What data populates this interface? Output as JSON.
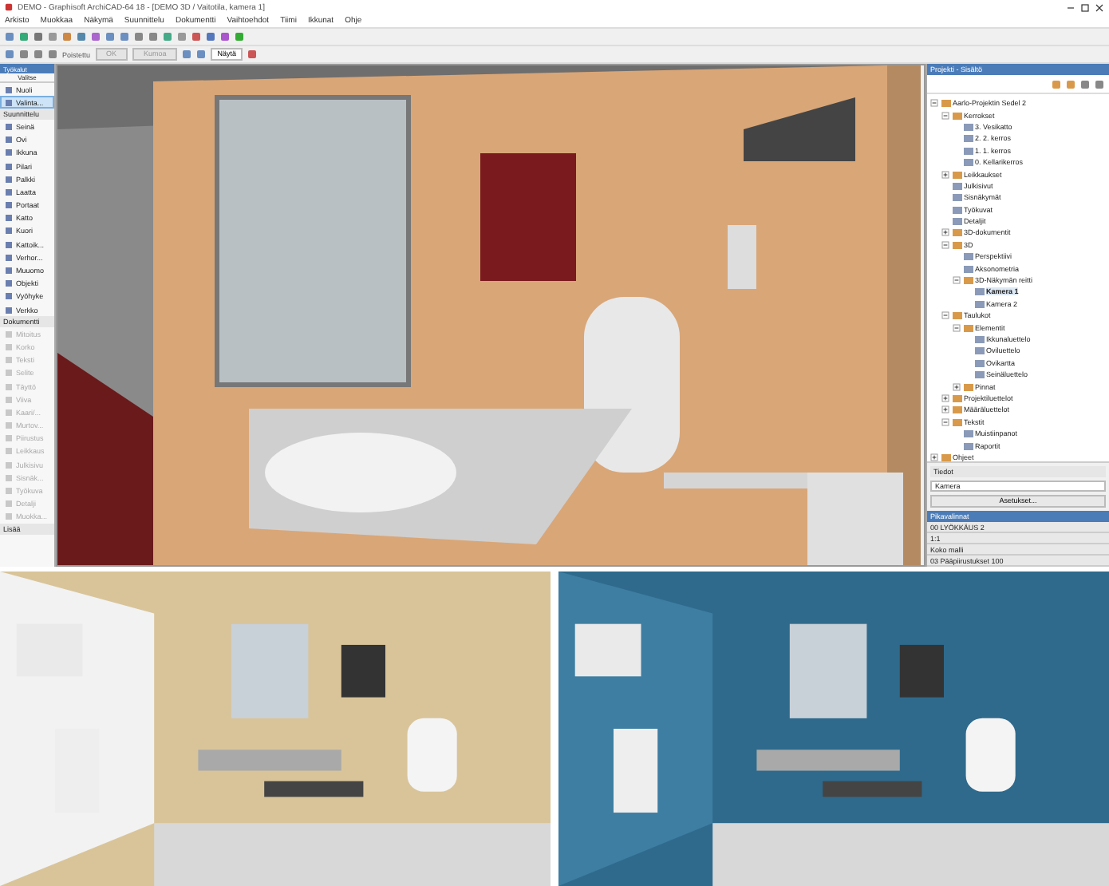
{
  "window": {
    "title": "DEMO - Graphisoft ArchiCAD-64 18 - [DEMO 3D / Vaitotila, kamera 1]"
  },
  "menu": [
    "Arkisto",
    "Muokkaa",
    "Näkymä",
    "Suunnittelu",
    "Dokumentti",
    "Vaihtoehdot",
    "Tiimi",
    "Ikkunat",
    "Ohje"
  ],
  "info_box": {
    "label": "Poistettu",
    "buttons": [
      "OK",
      "Kumoa"
    ],
    "dropdown": "Näytä"
  },
  "toolbox": {
    "title": "Työkalut",
    "mode": "Valitse",
    "items": [
      {
        "kind": "tool",
        "label": "Nuoli",
        "selected": false,
        "disabled": false
      },
      {
        "kind": "tool",
        "label": "Valinta...",
        "selected": true,
        "disabled": false
      },
      {
        "kind": "section",
        "label": "Suunnittelu"
      },
      {
        "kind": "tool",
        "label": "Seinä",
        "selected": false,
        "disabled": false
      },
      {
        "kind": "tool",
        "label": "Ovi",
        "selected": false,
        "disabled": false
      },
      {
        "kind": "tool",
        "label": "Ikkuna",
        "selected": false,
        "disabled": false
      },
      {
        "kind": "tool",
        "label": "Pilari",
        "selected": false,
        "disabled": false
      },
      {
        "kind": "tool",
        "label": "Palkki",
        "selected": false,
        "disabled": false
      },
      {
        "kind": "tool",
        "label": "Laatta",
        "selected": false,
        "disabled": false
      },
      {
        "kind": "tool",
        "label": "Portaat",
        "selected": false,
        "disabled": false
      },
      {
        "kind": "tool",
        "label": "Katto",
        "selected": false,
        "disabled": false
      },
      {
        "kind": "tool",
        "label": "Kuori",
        "selected": false,
        "disabled": false
      },
      {
        "kind": "tool",
        "label": "Kattoik...",
        "selected": false,
        "disabled": false
      },
      {
        "kind": "tool",
        "label": "Verhor...",
        "selected": false,
        "disabled": false
      },
      {
        "kind": "tool",
        "label": "Muuomo",
        "selected": false,
        "disabled": false
      },
      {
        "kind": "tool",
        "label": "Objekti",
        "selected": false,
        "disabled": false
      },
      {
        "kind": "tool",
        "label": "Vyöhyke",
        "selected": false,
        "disabled": false
      },
      {
        "kind": "tool",
        "label": "Verkko",
        "selected": false,
        "disabled": false
      },
      {
        "kind": "section",
        "label": "Dokumentti"
      },
      {
        "kind": "tool",
        "label": "Mitoitus",
        "selected": false,
        "disabled": true
      },
      {
        "kind": "tool",
        "label": "Korko",
        "selected": false,
        "disabled": true
      },
      {
        "kind": "tool",
        "label": "Teksti",
        "selected": false,
        "disabled": true
      },
      {
        "kind": "tool",
        "label": "Selite",
        "selected": false,
        "disabled": true
      },
      {
        "kind": "tool",
        "label": "Täyttö",
        "selected": false,
        "disabled": true
      },
      {
        "kind": "tool",
        "label": "Viiva",
        "selected": false,
        "disabled": true
      },
      {
        "kind": "tool",
        "label": "Kaari/...",
        "selected": false,
        "disabled": true
      },
      {
        "kind": "tool",
        "label": "Murtov...",
        "selected": false,
        "disabled": true
      },
      {
        "kind": "tool",
        "label": "Piirustus",
        "selected": false,
        "disabled": true
      },
      {
        "kind": "tool",
        "label": "Leikkaus",
        "selected": false,
        "disabled": true
      },
      {
        "kind": "tool",
        "label": "Julkisivu",
        "selected": false,
        "disabled": true
      },
      {
        "kind": "tool",
        "label": "Sisnäk...",
        "selected": false,
        "disabled": true
      },
      {
        "kind": "tool",
        "label": "Työkuva",
        "selected": false,
        "disabled": true
      },
      {
        "kind": "tool",
        "label": "Detalji",
        "selected": false,
        "disabled": true
      },
      {
        "kind": "tool",
        "label": "Muokka...",
        "selected": false,
        "disabled": true
      },
      {
        "kind": "section",
        "label": "Lisää"
      }
    ]
  },
  "navigator": {
    "title": "Projekti - Sisältö",
    "tree": [
      {
        "label": "Aarlo-Projektin Sedel 2",
        "expanded": true,
        "selected": false,
        "children": [
          {
            "label": "Kerrokset",
            "expanded": true,
            "selected": false,
            "children": [
              {
                "label": "3. Vesikatto",
                "selected": false
              },
              {
                "label": "2. 2. kerros",
                "selected": false
              },
              {
                "label": "1. 1. kerros",
                "selected": false
              },
              {
                "label": "0. Kellarikerros",
                "selected": false
              }
            ]
          },
          {
            "label": "Leikkaukset",
            "expanded": false,
            "selected": false
          },
          {
            "label": "Julkisivut",
            "selected": false
          },
          {
            "label": "Sisnäkymät",
            "selected": false
          },
          {
            "label": "Työkuvat",
            "selected": false
          },
          {
            "label": "Detaljit",
            "selected": false
          },
          {
            "label": "3D-dokumentit",
            "expanded": false,
            "selected": false
          },
          {
            "label": "3D",
            "expanded": true,
            "selected": false,
            "children": [
              {
                "label": "Perspektiivi",
                "selected": false
              },
              {
                "label": "Aksonometria",
                "selected": false
              },
              {
                "label": "3D-Näkymän reitti",
                "expanded": true,
                "selected": false,
                "children": [
                  {
                    "label": "Kamera 1",
                    "selected": true
                  },
                  {
                    "label": "Kamera 2",
                    "selected": false
                  }
                ]
              }
            ]
          },
          {
            "label": "Taulukot",
            "expanded": true,
            "selected": false,
            "children": [
              {
                "label": "Elementit",
                "expanded": true,
                "selected": false,
                "children": [
                  {
                    "label": "Ikkunaluettelo",
                    "selected": false
                  },
                  {
                    "label": "Oviluettelo",
                    "selected": false
                  },
                  {
                    "label": "Ovikartta",
                    "selected": false
                  },
                  {
                    "label": "Seinäluettelo",
                    "selected": false
                  }
                ]
              },
              {
                "label": "Pinnat",
                "expanded": false,
                "selected": false
              }
            ]
          },
          {
            "label": "Projektiluettelot",
            "expanded": false,
            "selected": false
          },
          {
            "label": "Määräluettelot",
            "expanded": false,
            "selected": false
          },
          {
            "label": "Tekstit",
            "expanded": true,
            "selected": false,
            "children": [
              {
                "label": "Muistiinpanot",
                "selected": false
              },
              {
                "label": "Raportit",
                "selected": false
              }
            ]
          }
        ]
      },
      {
        "label": "Ohjeet",
        "expanded": false,
        "selected": false
      }
    ],
    "info_title": "Tiedot",
    "name_label": "Kamera",
    "settings_button": "Asetukset...",
    "quick_options": {
      "title": "Pikavalinnat",
      "rows": [
        "00 LYÖKKÄUS 2",
        "1:1",
        "Koko malli",
        "03 Pääpiirustukset 100"
      ]
    }
  }
}
